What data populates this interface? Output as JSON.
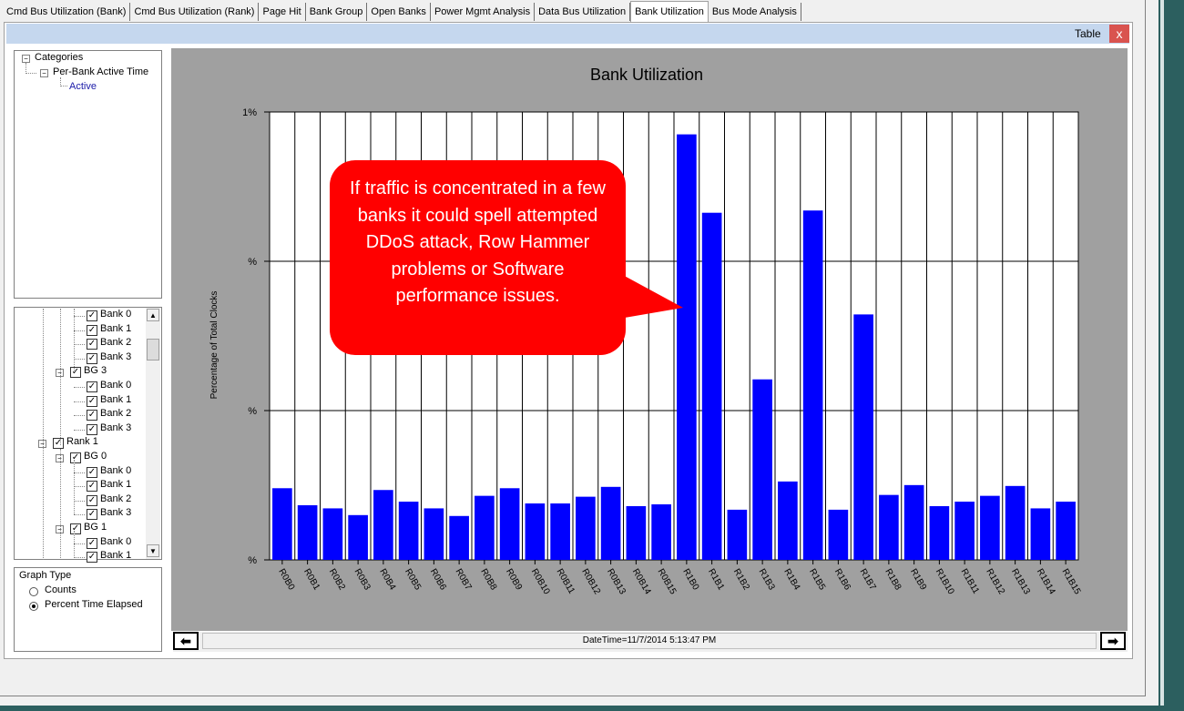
{
  "tabs": [
    {
      "label": "Cmd Bus Utilization (Bank)",
      "active": false
    },
    {
      "label": "Cmd Bus Utilization (Rank)",
      "active": false
    },
    {
      "label": "Page Hit",
      "active": false
    },
    {
      "label": "Bank Group",
      "active": false
    },
    {
      "label": "Open Banks",
      "active": false
    },
    {
      "label": "Power Mgmt Analysis",
      "active": false
    },
    {
      "label": "Data Bus Utilization",
      "active": false
    },
    {
      "label": "Bank Utilization",
      "active": true
    },
    {
      "label": "Bus Mode Analysis",
      "active": false
    }
  ],
  "header": {
    "table_label": "Table",
    "close_glyph": "x"
  },
  "categories": {
    "root": "Categories",
    "child": "Per-Bank Active Time",
    "leaf": "Active"
  },
  "tree": [
    {
      "type": "bank",
      "label": "Bank 0"
    },
    {
      "type": "bank",
      "label": "Bank 1"
    },
    {
      "type": "bank",
      "label": "Bank 2"
    },
    {
      "type": "bank",
      "label": "Bank 3"
    },
    {
      "type": "bg",
      "label": "BG 3"
    },
    {
      "type": "bank",
      "label": "Bank 0"
    },
    {
      "type": "bank",
      "label": "Bank 1"
    },
    {
      "type": "bank",
      "label": "Bank 2"
    },
    {
      "type": "bank",
      "label": "Bank 3"
    },
    {
      "type": "rank",
      "label": "Rank 1"
    },
    {
      "type": "bg",
      "label": "BG 0"
    },
    {
      "type": "bank",
      "label": "Bank 0"
    },
    {
      "type": "bank",
      "label": "Bank 1"
    },
    {
      "type": "bank",
      "label": "Bank 2"
    },
    {
      "type": "bank",
      "label": "Bank 3"
    },
    {
      "type": "bg",
      "label": "BG 1"
    },
    {
      "type": "bank",
      "label": "Bank 0"
    },
    {
      "type": "bank",
      "label": "Bank 1"
    }
  ],
  "graph_type": {
    "title": "Graph Type",
    "options": [
      {
        "label": "Counts",
        "selected": false
      },
      {
        "label": "Percent Time Elapsed",
        "selected": true
      }
    ]
  },
  "footer": {
    "datetime": "DateTime=11/7/2014 5:13:47 PM"
  },
  "callout": {
    "text": "If traffic is concentrated in a few banks it could spell attempted DDoS attack, Row Hammer problems or Software performance issues."
  },
  "colors": {
    "bar": "#0000ff",
    "callout": "#ff0000",
    "chart_bg": "#a0a0a0"
  },
  "chart_data": {
    "type": "bar",
    "title": "Bank Utilization",
    "ylabel": "Percentage of Total Clocks",
    "xlabel": "",
    "yticks": [
      "1%",
      "%",
      "%",
      "%"
    ],
    "ylim": [
      0,
      1
    ],
    "grid": true,
    "categories": [
      "R0B0",
      "R0B1",
      "R0B2",
      "R0B3",
      "R0B4",
      "R0B5",
      "R0B6",
      "R0B7",
      "R0B8",
      "R0B9",
      "R0B10",
      "R0B11",
      "R0B12",
      "R0B13",
      "R0B14",
      "R0B15",
      "R1B0",
      "R1B1",
      "R1B2",
      "R1B3",
      "R1B4",
      "R1B5",
      "R1B6",
      "R1B7",
      "R1B8",
      "R1B9",
      "R1B10",
      "R1B11",
      "R1B12",
      "R1B13",
      "R1B14",
      "R1B15"
    ],
    "values": [
      0.16,
      0.122,
      0.115,
      0.1,
      0.156,
      0.13,
      0.115,
      0.098,
      0.143,
      0.16,
      0.126,
      0.126,
      0.141,
      0.163,
      0.12,
      0.124,
      0.95,
      0.775,
      0.112,
      0.403,
      0.175,
      0.78,
      0.112,
      0.548,
      0.145,
      0.167,
      0.12,
      0.13,
      0.143,
      0.165,
      0.115,
      0.13
    ]
  }
}
